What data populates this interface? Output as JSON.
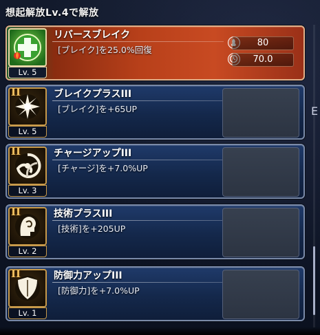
{
  "header": {
    "title": "想起解放Lv.4で解放"
  },
  "skills": [
    {
      "tier": "",
      "name": "リバースブレイク",
      "desc": "[ブレイク]を25.0%回復",
      "level": "Lv. 5",
      "icon": "cross-heal-icon",
      "active": true
    },
    {
      "tier": "II",
      "name": "ブレイクプラスIII",
      "desc": "[ブレイク]を+65UP",
      "level": "Lv. 5",
      "icon": "starburst-icon",
      "active": false
    },
    {
      "tier": "II",
      "name": "チャージアップIII",
      "desc": "[チャージ]を+7.0%UP",
      "level": "Lv. 3",
      "icon": "swirl-icon",
      "active": false
    },
    {
      "tier": "II",
      "name": "技術プラスIII",
      "desc": "[技術]を+205UP",
      "level": "Lv. 2",
      "icon": "head-swirl-icon",
      "active": false
    },
    {
      "tier": "II",
      "name": "防御力アップIII",
      "desc": "[防御力]を+7.0%UP",
      "level": "Lv. 1",
      "icon": "shield-icon",
      "active": false
    }
  ],
  "active_stats": {
    "cost": "80",
    "charge": "70.0"
  },
  "side": {
    "letter": "E"
  },
  "colors": {
    "active_card": "#c84a22",
    "card": "#1f3a6a",
    "tier": "#f0c060",
    "border": "#7a8aa8"
  }
}
